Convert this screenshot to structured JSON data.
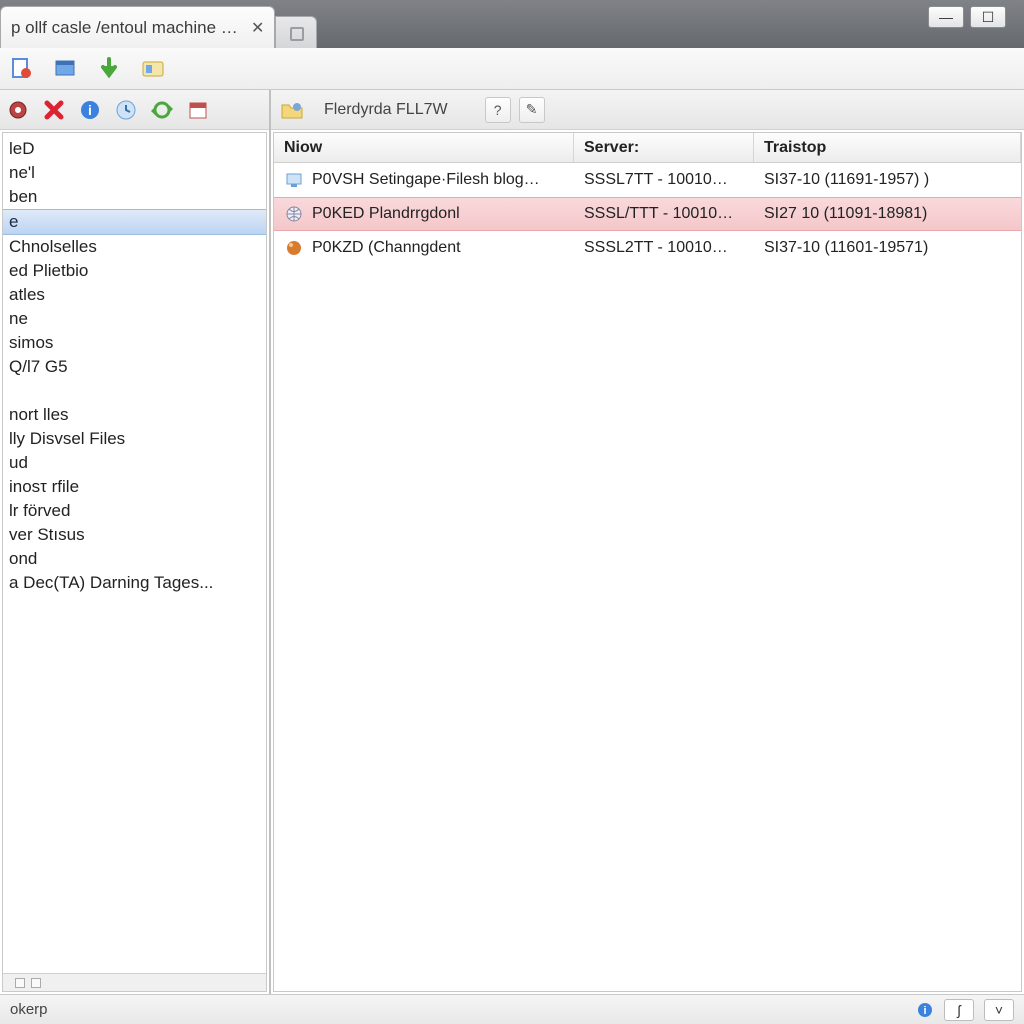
{
  "tab": {
    "label": "p ollf casle /entoul machine in..."
  },
  "window_buttons": {
    "minimize": "—",
    "restore": "☐"
  },
  "main_toolbar_icons": [
    "doc-new",
    "window-blue",
    "arrow-down-green",
    "id-card"
  ],
  "left_toolbar_icons": [
    "gear-red",
    "delete-red",
    "info-blue",
    "clock-blue",
    "arrows-green",
    "calendar-red"
  ],
  "right_toolbar": {
    "label": "Flerdyrda FLL7W",
    "btn1": "?",
    "btn2": "✎"
  },
  "tree_selected_index": 3,
  "tree_items": [
    "leD",
    "ne'l",
    "ben",
    "e",
    "Chnolselles",
    "ed Plietbio",
    "atles",
    "ne",
    "simos",
    "Q/l7 G5",
    "",
    "nort lles",
    "lly Disvsel Files",
    "ud",
    "inosτ rfile",
    "lr förved",
    "ver Stısus",
    "ond",
    "a Dec(TA) Darning Tages..."
  ],
  "grid": {
    "columns": {
      "niow": "Niow",
      "server": "Server:",
      "traistop": "Traistop"
    },
    "rows": [
      {
        "icon": "monitor",
        "niow": "P0VSH Setingape·Filesh blog…",
        "server": "SSSL7TT - 10010…",
        "traistop": "SI37-10 (11691‑1957) )",
        "highlight": false
      },
      {
        "icon": "globe",
        "niow": "P0KED Plandrrgdonl",
        "server": "SSSL/TTT - 10010…",
        "traistop": "SI27 10 (11091‑18981)",
        "highlight": true
      },
      {
        "icon": "orb",
        "niow": "P0KZD (Channgdent",
        "server": "SSSL2TT - 10010…",
        "traistop": "SI37-10 (11601‑19571)",
        "highlight": false
      }
    ]
  },
  "statusbar": {
    "left": "okerp",
    "right_btn1": "ʃ",
    "right_btn2": "˅"
  }
}
